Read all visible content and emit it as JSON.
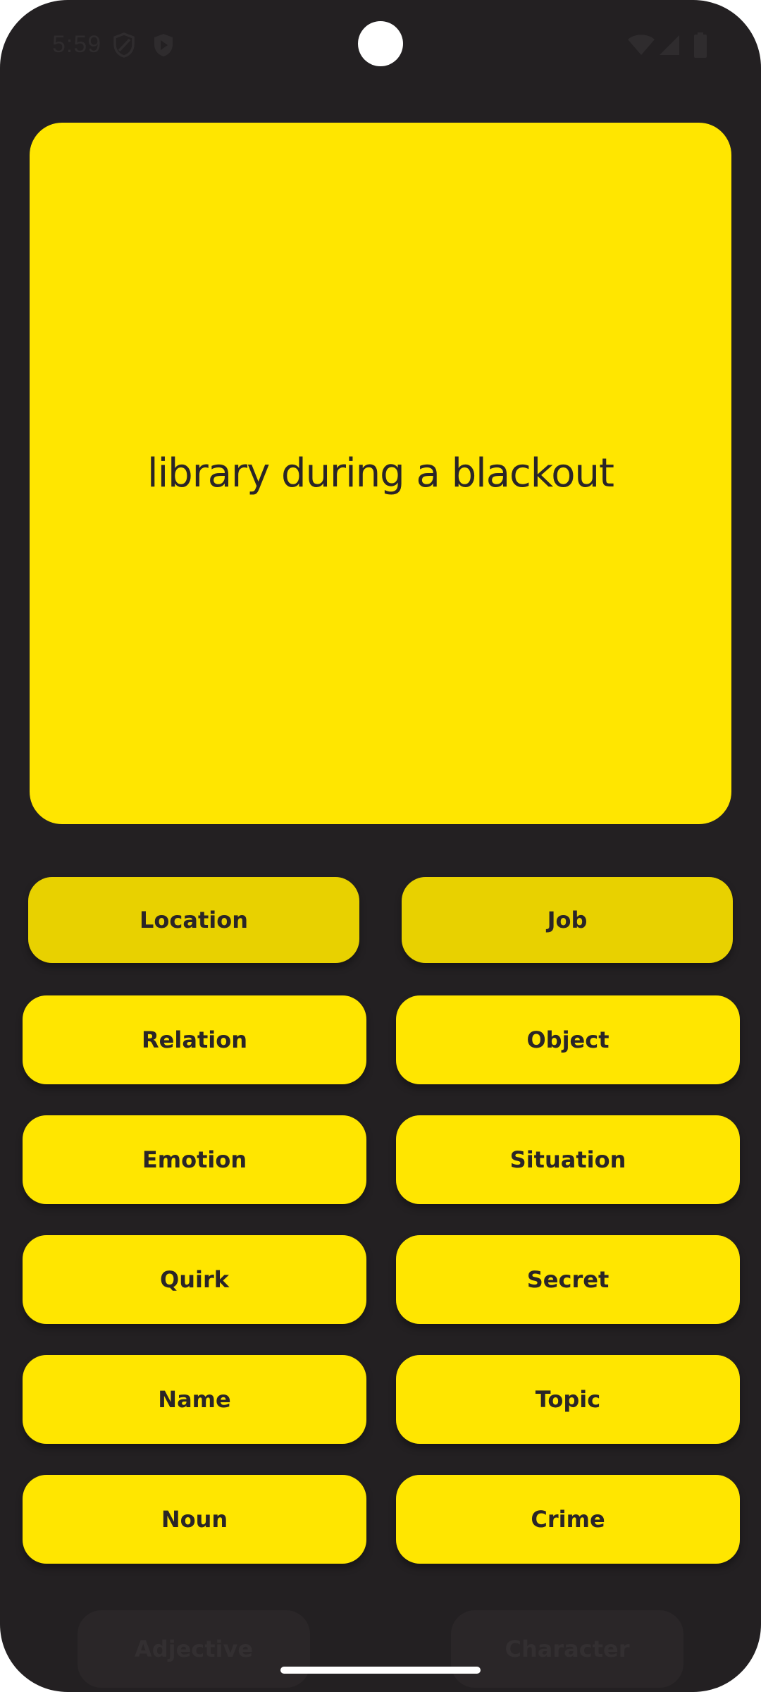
{
  "status_bar": {
    "time": "5:59",
    "left_icons": [
      "shield-icon",
      "play-protect-icon"
    ],
    "right_icons": [
      "wifi-icon",
      "signal-icon",
      "battery-icon"
    ]
  },
  "prompt": {
    "text": "library during a blackout"
  },
  "colors": {
    "background": "#232022",
    "accent": "#ffe600",
    "selected": "#e8d100",
    "text": "#2a2527"
  },
  "categories": [
    {
      "label": "Location",
      "selected": true
    },
    {
      "label": "Job",
      "selected": true
    },
    {
      "label": "Relation",
      "selected": false
    },
    {
      "label": "Object",
      "selected": false
    },
    {
      "label": "Emotion",
      "selected": false
    },
    {
      "label": "Situation",
      "selected": false
    },
    {
      "label": "Quirk",
      "selected": false
    },
    {
      "label": "Secret",
      "selected": false
    },
    {
      "label": "Name",
      "selected": false
    },
    {
      "label": "Topic",
      "selected": false
    },
    {
      "label": "Noun",
      "selected": false
    },
    {
      "label": "Crime",
      "selected": false
    },
    {
      "label": "Adjective",
      "selected": false
    },
    {
      "label": "Character",
      "selected": false
    }
  ]
}
